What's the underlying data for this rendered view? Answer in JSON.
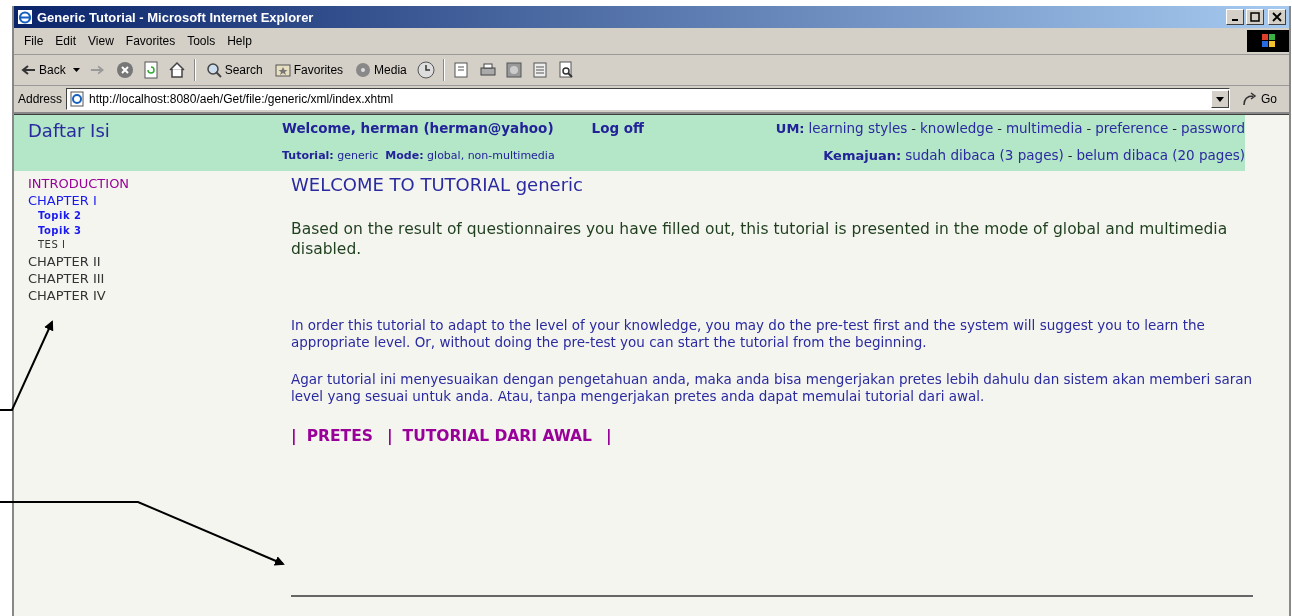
{
  "window": {
    "title": "Generic Tutorial - Microsoft Internet Explorer"
  },
  "menu": [
    "File",
    "Edit",
    "View",
    "Favorites",
    "Tools",
    "Help"
  ],
  "toolbar": {
    "back": "Back",
    "search": "Search",
    "favorites": "Favorites",
    "media": "Media"
  },
  "address": {
    "label": "Address",
    "url": "http://localhost:8080/aeh/Get/file:/generic/xml/index.xhtml",
    "go": "Go"
  },
  "header": {
    "title": "Daftar Isi",
    "welcome": "Welcome, herman (herman@yahoo)",
    "logoff": "Log off",
    "um_label": "UM:",
    "separator": "-",
    "um_links": [
      "learning styles",
      "knowledge",
      "multimedia",
      "preference",
      "password"
    ],
    "tutorial_label": "Tutorial:",
    "tutorial": "generic",
    "mode_label": "Mode:",
    "mode": "global, non-multimedia",
    "progress_label": "Kemajuan:",
    "read": "sudah dibaca (3 pages)",
    "progress_sep": "-",
    "unread": "belum dibaca (20 pages)"
  },
  "sidebar": {
    "items": [
      {
        "label": "INTRODUCTION",
        "kind": "visited"
      },
      {
        "label": "CHAPTER I",
        "kind": "link",
        "children": [
          {
            "label": "Topik 2",
            "kind": "link"
          },
          {
            "label": "Topik 3",
            "kind": "link"
          },
          {
            "label": "TES I",
            "kind": "plain"
          }
        ]
      },
      {
        "label": "CHAPTER II",
        "kind": "plain"
      },
      {
        "label": "CHAPTER III",
        "kind": "plain"
      },
      {
        "label": "CHAPTER IV",
        "kind": "plain"
      }
    ]
  },
  "content": {
    "heading": "WELCOME TO TUTORIAL generic",
    "intro": "Based on the result of questionnaires you have filled out, this tutorial is presented in the mode of global and multimedia disabled.",
    "paragraphs": [
      "In order this tutorial to adapt to the level of your knowledge, you may do the pre-test first and the system will suggest you to learn the appropriate level. Or, without doing the pre-test you can start the tutorial from the beginning.",
      "Agar tutorial ini menyesuaikan dengan pengetahuan anda, maka anda bisa mengerjakan pretes lebih dahulu dan sistem akan memberi saran level yang sesuai untuk anda. Atau, tanpa mengerjakan pretes anda dapat memulai tutorial dari awal."
    ],
    "nav_separator": "|",
    "nav_links": [
      "PRETES",
      "TUTORIAL DARI AWAL"
    ]
  }
}
